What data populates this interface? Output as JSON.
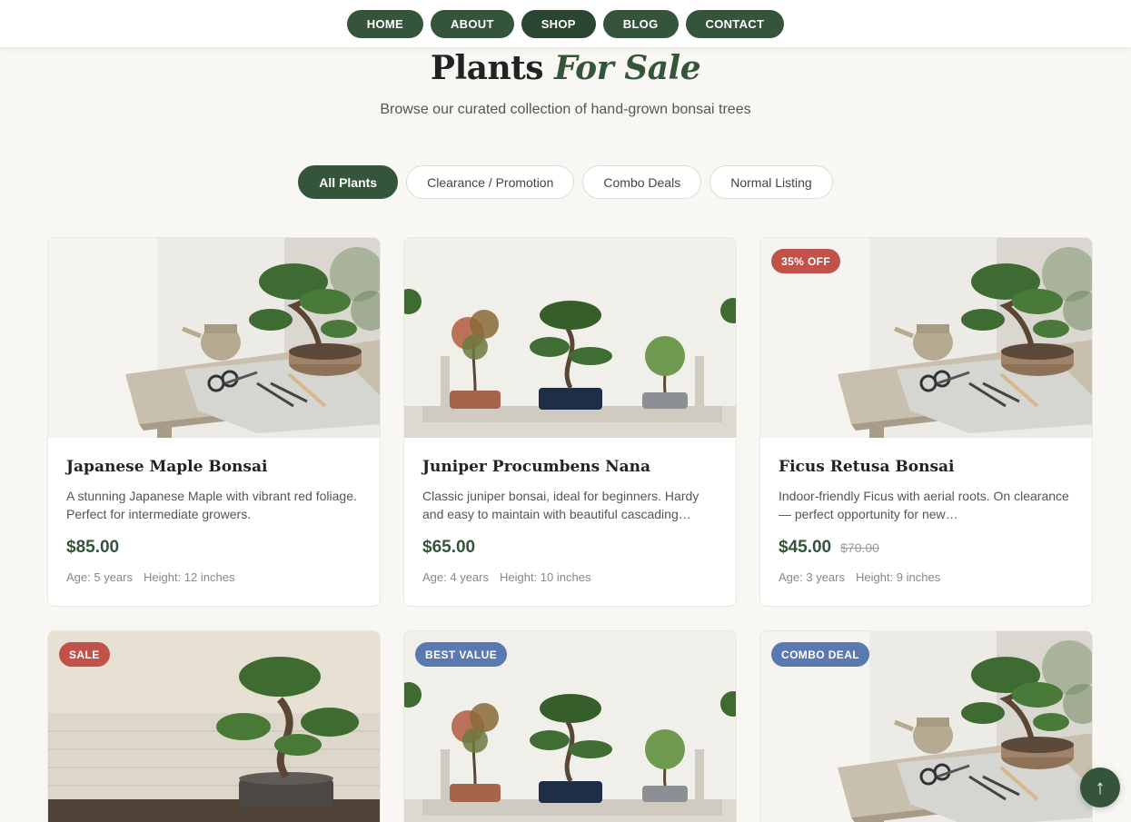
{
  "nav": {
    "items": [
      {
        "label": "HOME"
      },
      {
        "label": "ABOUT"
      },
      {
        "label": "SHOP"
      },
      {
        "label": "BLOG"
      },
      {
        "label": "CONTACT"
      }
    ],
    "active": "SHOP"
  },
  "header": {
    "title_main": "Plants",
    "title_accent": "For Sale",
    "subtitle": "Browse our curated collection of hand-grown bonsai trees"
  },
  "filters": {
    "items": [
      {
        "label": "All Plants"
      },
      {
        "label": "Clearance / Promotion"
      },
      {
        "label": "Combo Deals"
      },
      {
        "label": "Normal Listing"
      }
    ],
    "active": "All Plants"
  },
  "products": [
    {
      "title": "Japanese Maple Bonsai",
      "description": "A stunning Japanese Maple with vibrant red foliage. Perfect for intermediate growers.",
      "price": "$85.00",
      "age": "Age: 5 years",
      "height": "Height: 12 inches"
    },
    {
      "title": "Juniper Procumbens Nana",
      "description": "Classic juniper bonsai, ideal for beginners. Hardy and easy to maintain with beautiful cascading…",
      "price": "$65.00",
      "age": "Age: 4 years",
      "height": "Height: 10 inches"
    },
    {
      "title": "Ficus Retusa Bonsai",
      "description": "Indoor-friendly Ficus with aerial roots. On clearance — perfect opportunity for new…",
      "price": "$45.00",
      "old_price": "$70.00",
      "badge": "35% OFF",
      "age": "Age: 3 years",
      "height": "Height: 9 inches"
    },
    {
      "badge": "SALE"
    },
    {
      "badge": "BEST VALUE"
    },
    {
      "badge": "COMBO DEAL"
    }
  ],
  "colors": {
    "primary": "#35553b",
    "badge_red": "#c0524a",
    "badge_blue": "#5a79b0",
    "background": "#f8f7f4"
  },
  "scroll_top": {
    "icon": "arrow-up-icon",
    "glyph": "↑"
  }
}
